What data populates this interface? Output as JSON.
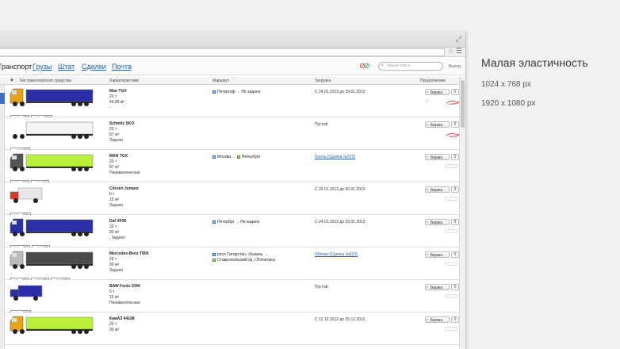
{
  "side_notes": {
    "title": "Малая эластичность",
    "res1": "1024 x 768 px",
    "res2": "1920 x 1080 px"
  },
  "nav": {
    "current": "Транспорт",
    "links": [
      "Грузы",
      "Штат",
      "Сделки",
      "Почта"
    ],
    "search_placeholder": "Умный поиск",
    "logout": "Выход"
  },
  "table": {
    "headers": [
      "Тип транспортного средства",
      "Характеристики",
      "Маршрут",
      "Загрузка",
      "Продолжение"
    ],
    "action_label": "Биржа",
    "action_count": "0",
    "rows": [
      {
        "model": "Man TGX",
        "lines": [
          "20 т",
          "44,85 м³",
          "-"
        ],
        "from": "Петергоф",
        "to": "Не задано",
        "load": "С 24.01.2013 до 29.01.2013",
        "load_link": false,
        "plates": [
          [
            "м357ев",
            "26"
          ],
          [
            "м345ее",
            "177"
          ]
        ],
        "truck_color": "#2a2fa8",
        "cab_color": "#e8a317"
      },
      {
        "model": "Schmitz SKO",
        "lines": [
          "20 т",
          "87 м³",
          "Задняя"
        ],
        "from": "",
        "to": "",
        "load": "Пустой",
        "load_link": false,
        "plates": [
          [
            "мм0810",
            "26"
          ]
        ],
        "truck_color": "#f5f5f5",
        "cab_color": ""
      },
      {
        "model": "MAN TGX",
        "lines": [
          "20 т",
          "87 м³",
          "Пневматическая"
        ],
        "from": "Москва",
        "to": "Петербург",
        "load": "Хрень (Сделка №672)",
        "load_link": true,
        "plates": [
          [
            "м574ек",
            "26"
          ],
          [
            "уу4467",
            "64"
          ]
        ],
        "truck_color": "#b9f03a",
        "cab_color": "#555555"
      },
      {
        "model": "Citroen Jumper",
        "lines": [
          "5 т",
          "15 м³",
          "Задняя"
        ],
        "from": "",
        "to": "",
        "load": "С 29.01.2013 до 30.01.2013",
        "load_link": false,
        "plates": [
          [
            "н100нн",
            "177"
          ]
        ],
        "truck_color": "#e8e8e8",
        "cab_color": "#d23a2a"
      },
      {
        "model": "Daf XF95",
        "lines": [
          "20 т",
          "90 м³",
          ", Задняя"
        ],
        "from": "Петербрг",
        "to": "Не задано",
        "load": "С 24.01.2013 до 29.01.2013",
        "load_link": false,
        "plates": [
          [
            "м808ем",
            "26"
          ],
          [
            "уу1011",
            "27"
          ]
        ],
        "truck_color": "#2a2fa8",
        "cab_color": "#2a2fa8"
      },
      {
        "model": "Mercedes-Benz T800",
        "lines": [
          "20 т",
          "90 м³",
          "Задняя"
        ],
        "from": "респ Татарстан, г.Казань",
        "to": "Ставропольский кр, г.Пятигорск",
        "load": "Яблоки (Сделка №623)",
        "load_link": true,
        "plates": [
          [
            "м111оо",
            "26"
          ],
          [
            "уу1290",
            "26"
          ],
          [
            "рр8888",
            "26"
          ]
        ],
        "truck_color": "#4a4a4a",
        "cab_color": "#bbbbbb"
      },
      {
        "model": "BAW Fenix 1044",
        "lines": [
          "5 т",
          "15 м³",
          "Пневматическая"
        ],
        "from": "",
        "to": "",
        "load": "Пустой",
        "load_link": false,
        "plates": [
          [
            "н100нн",
            "177"
          ]
        ],
        "truck_color": "#2a2fa8",
        "cab_color": "#2a2fa8"
      },
      {
        "model": "КамАЗ 44108",
        "lines": [
          "20 т",
          "90 м³",
          ""
        ],
        "from": "",
        "to": "",
        "load": "С 12.12.2012 до 25.12.2012",
        "load_link": false,
        "plates": [],
        "truck_color": "#b9f03a",
        "cab_color": "#e8a317"
      }
    ]
  }
}
